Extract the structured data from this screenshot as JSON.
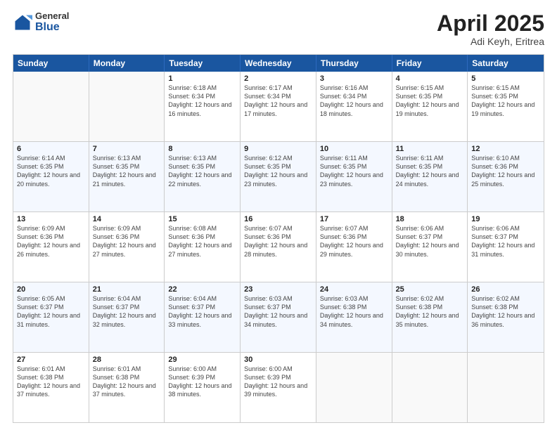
{
  "header": {
    "logo_general": "General",
    "logo_blue": "Blue",
    "title": "April 2025",
    "location": "Adi Keyh, Eritrea"
  },
  "calendar": {
    "days_of_week": [
      "Sunday",
      "Monday",
      "Tuesday",
      "Wednesday",
      "Thursday",
      "Friday",
      "Saturday"
    ],
    "rows": [
      [
        {
          "day": "",
          "info": ""
        },
        {
          "day": "",
          "info": ""
        },
        {
          "day": "1",
          "info": "Sunrise: 6:18 AM\nSunset: 6:34 PM\nDaylight: 12 hours and 16 minutes."
        },
        {
          "day": "2",
          "info": "Sunrise: 6:17 AM\nSunset: 6:34 PM\nDaylight: 12 hours and 17 minutes."
        },
        {
          "day": "3",
          "info": "Sunrise: 6:16 AM\nSunset: 6:34 PM\nDaylight: 12 hours and 18 minutes."
        },
        {
          "day": "4",
          "info": "Sunrise: 6:15 AM\nSunset: 6:35 PM\nDaylight: 12 hours and 19 minutes."
        },
        {
          "day": "5",
          "info": "Sunrise: 6:15 AM\nSunset: 6:35 PM\nDaylight: 12 hours and 19 minutes."
        }
      ],
      [
        {
          "day": "6",
          "info": "Sunrise: 6:14 AM\nSunset: 6:35 PM\nDaylight: 12 hours and 20 minutes."
        },
        {
          "day": "7",
          "info": "Sunrise: 6:13 AM\nSunset: 6:35 PM\nDaylight: 12 hours and 21 minutes."
        },
        {
          "day": "8",
          "info": "Sunrise: 6:13 AM\nSunset: 6:35 PM\nDaylight: 12 hours and 22 minutes."
        },
        {
          "day": "9",
          "info": "Sunrise: 6:12 AM\nSunset: 6:35 PM\nDaylight: 12 hours and 23 minutes."
        },
        {
          "day": "10",
          "info": "Sunrise: 6:11 AM\nSunset: 6:35 PM\nDaylight: 12 hours and 23 minutes."
        },
        {
          "day": "11",
          "info": "Sunrise: 6:11 AM\nSunset: 6:35 PM\nDaylight: 12 hours and 24 minutes."
        },
        {
          "day": "12",
          "info": "Sunrise: 6:10 AM\nSunset: 6:36 PM\nDaylight: 12 hours and 25 minutes."
        }
      ],
      [
        {
          "day": "13",
          "info": "Sunrise: 6:09 AM\nSunset: 6:36 PM\nDaylight: 12 hours and 26 minutes."
        },
        {
          "day": "14",
          "info": "Sunrise: 6:09 AM\nSunset: 6:36 PM\nDaylight: 12 hours and 27 minutes."
        },
        {
          "day": "15",
          "info": "Sunrise: 6:08 AM\nSunset: 6:36 PM\nDaylight: 12 hours and 27 minutes."
        },
        {
          "day": "16",
          "info": "Sunrise: 6:07 AM\nSunset: 6:36 PM\nDaylight: 12 hours and 28 minutes."
        },
        {
          "day": "17",
          "info": "Sunrise: 6:07 AM\nSunset: 6:36 PM\nDaylight: 12 hours and 29 minutes."
        },
        {
          "day": "18",
          "info": "Sunrise: 6:06 AM\nSunset: 6:37 PM\nDaylight: 12 hours and 30 minutes."
        },
        {
          "day": "19",
          "info": "Sunrise: 6:06 AM\nSunset: 6:37 PM\nDaylight: 12 hours and 31 minutes."
        }
      ],
      [
        {
          "day": "20",
          "info": "Sunrise: 6:05 AM\nSunset: 6:37 PM\nDaylight: 12 hours and 31 minutes."
        },
        {
          "day": "21",
          "info": "Sunrise: 6:04 AM\nSunset: 6:37 PM\nDaylight: 12 hours and 32 minutes."
        },
        {
          "day": "22",
          "info": "Sunrise: 6:04 AM\nSunset: 6:37 PM\nDaylight: 12 hours and 33 minutes."
        },
        {
          "day": "23",
          "info": "Sunrise: 6:03 AM\nSunset: 6:37 PM\nDaylight: 12 hours and 34 minutes."
        },
        {
          "day": "24",
          "info": "Sunrise: 6:03 AM\nSunset: 6:38 PM\nDaylight: 12 hours and 34 minutes."
        },
        {
          "day": "25",
          "info": "Sunrise: 6:02 AM\nSunset: 6:38 PM\nDaylight: 12 hours and 35 minutes."
        },
        {
          "day": "26",
          "info": "Sunrise: 6:02 AM\nSunset: 6:38 PM\nDaylight: 12 hours and 36 minutes."
        }
      ],
      [
        {
          "day": "27",
          "info": "Sunrise: 6:01 AM\nSunset: 6:38 PM\nDaylight: 12 hours and 37 minutes."
        },
        {
          "day": "28",
          "info": "Sunrise: 6:01 AM\nSunset: 6:38 PM\nDaylight: 12 hours and 37 minutes."
        },
        {
          "day": "29",
          "info": "Sunrise: 6:00 AM\nSunset: 6:39 PM\nDaylight: 12 hours and 38 minutes."
        },
        {
          "day": "30",
          "info": "Sunrise: 6:00 AM\nSunset: 6:39 PM\nDaylight: 12 hours and 39 minutes."
        },
        {
          "day": "",
          "info": ""
        },
        {
          "day": "",
          "info": ""
        },
        {
          "day": "",
          "info": ""
        }
      ]
    ]
  }
}
